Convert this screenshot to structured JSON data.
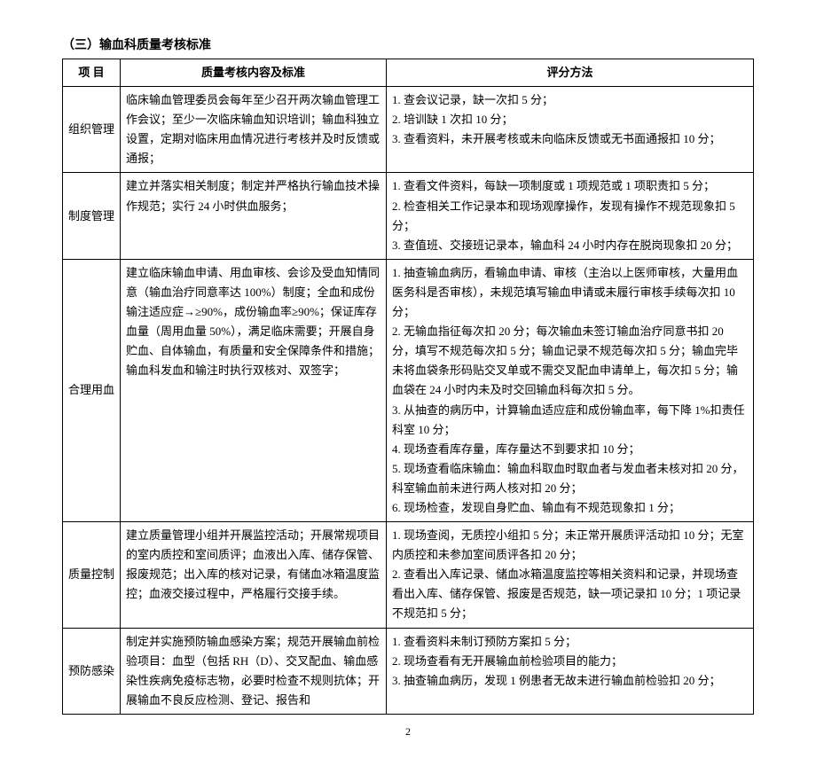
{
  "title": "（三）输血科质量考核标准",
  "headers": {
    "col1": "项  目",
    "col2": "质量考核内容及标准",
    "col3": "评分方法"
  },
  "rows": [
    {
      "name": "组织管理",
      "content": "临床输血管理委员会每年至少召开两次输血管理工作会议；至少一次临床输血知识培训；输血科独立设置，定期对临床用血情况进行考核并及时反馈或通报；",
      "method": "1. 查会议记录，缺一次扣 5 分；\n2. 培训缺 1 次扣 10 分；\n3. 查看资料，未开展考核或未向临床反馈或无书面通报扣 10 分；"
    },
    {
      "name": "制度管理",
      "content": "建立并落实相关制度；制定并严格执行输血技术操作规范；实行 24 小时供血服务；",
      "method": "1. 查看文件资料，每缺一项制度或 1 项规范或 1 项职责扣 5 分；\n2. 检查相关工作记录本和现场观摩操作，发现有操作不规范现象扣 5 分；\n3. 查值班、交接班记录本，输血科 24 小时内存在脱岗现象扣 20 分；"
    },
    {
      "name": "合理用血",
      "content": "建立临床输血申请、用血审核、会诊及受血知情同意（输血治疗同意率达 100%）制度；全血和成份输注适应症→≥90%，成份输血率≥90%；保证库存血量（周用血量 50%），满足临床需要；开展自身贮血、自体输血，有质量和安全保障条件和措施；输血科发血和输注时执行双核对、双签字；",
      "method": "1. 抽查输血病历，看输血申请、审核（主治以上医师审核，大量用血医务科是否审核），未规范填写输血申请或未履行审核手续每次扣 10 分；\n2. 无输血指征每次扣 20 分；每次输血未签订输血治疗同意书扣 20 分，填写不规范每次扣 5 分；输血记录不规范每次扣 5 分；输血完毕未将血袋条形码贴交叉单或不需交叉配血申请单上，每次扣 5 分；输血袋在 24 小时内未及时交回输血科每次扣 5 分。\n3. 从抽查的病历中，计算输血适应症和成份输血率，每下降 1%扣责任科室 10 分；\n4. 现场查看库存量，库存量达不到要求扣 10 分；\n5. 现场查看临床输血：输血科取血时取血者与发血者未核对扣 20 分，科室输血前未进行两人核对扣 20 分；\n6. 现场检查，发现自身贮血、输血有不规范现象扣 1 分；"
    },
    {
      "name": "质量控制",
      "content": "建立质量管理小组并开展监控活动；开展常规项目的室内质控和室间质评；血液出入库、储存保管、报废规范；出入库的核对记录，有储血冰箱温度监控；血液交接过程中，严格履行交接手续。",
      "method": "1. 现场查阅，无质控小组扣 5 分；未正常开展质评活动扣 10 分；无室内质控和未参加室间质评各扣 20 分；\n2. 查看出入库记录、储血冰箱温度监控等相关资料和记录，并现场查看出入库、储存保管、报废是否规范，缺一项记录扣 10 分；1 项记录不规范扣 5 分；"
    },
    {
      "name": "预防感染",
      "content": "制定并实施预防输血感染方案；规范开展输血前检验项目：血型（包括 RH（D）、交叉配血、输血感染性疾病免疫标志物，必要时检查不规则抗体；开展输血不良反应检测、登记、报告和",
      "method": "1. 查看资料未制订预防方案扣 5 分；\n2. 现场查看有无开展输血前检验项目的能力；\n3. 抽查输血病历，发现 1 例患者无故未进行输血前检验扣 20 分；"
    }
  ],
  "pageNumber": "2"
}
